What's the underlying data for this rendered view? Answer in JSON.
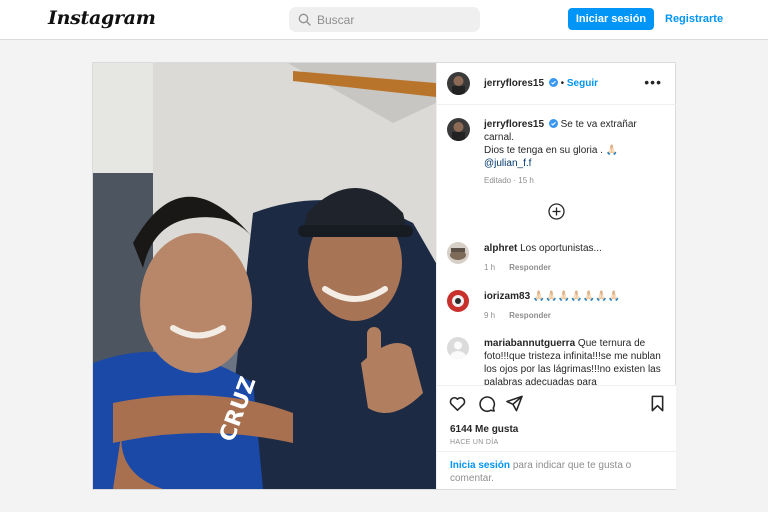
{
  "header": {
    "logo": "Instagram",
    "search_placeholder": "Buscar",
    "login_button": "Iniciar sesión",
    "signup_link": "Registrarte"
  },
  "post": {
    "author": "jerryflores15",
    "follow": "Seguir",
    "caption": {
      "line1": "Se te va extrañar",
      "line2": "carnal.",
      "line3": "Dios te tenga en su gloria . 🙏🏻",
      "mention": "@julian_f.f"
    },
    "edited": "Editado",
    "edited_time": "15 h",
    "comments": [
      {
        "user": "alphret",
        "text": "Los oportunistas...",
        "time": "1 h",
        "reply": "Responder"
      },
      {
        "user": "iorizam83",
        "text": "🙏🏻🙏🏻🙏🏻🙏🏻🙏🏻🙏🏻🙏🏻",
        "time": "9 h",
        "reply": "Responder"
      },
      {
        "user": "mariabannutguerra",
        "text": "Que ternura de foto!!!que tristeza infinita!!!se me nublan los ojos por las lágrimas!!!no existen las palabras adecuadas para"
      }
    ],
    "likes": "6144 Me gusta",
    "time_ago": "HACE UN DÍA",
    "login_link": "Inicia sesión",
    "login_text": "para indicar que te gusta o comentar."
  },
  "colors": {
    "accent": "#0095f6",
    "verified": "#3897f0"
  },
  "icons": [
    "search-icon",
    "verified-badge-icon",
    "more-options-icon",
    "add-comment-icon",
    "heart-icon",
    "comment-icon",
    "share-icon",
    "bookmark-icon"
  ]
}
